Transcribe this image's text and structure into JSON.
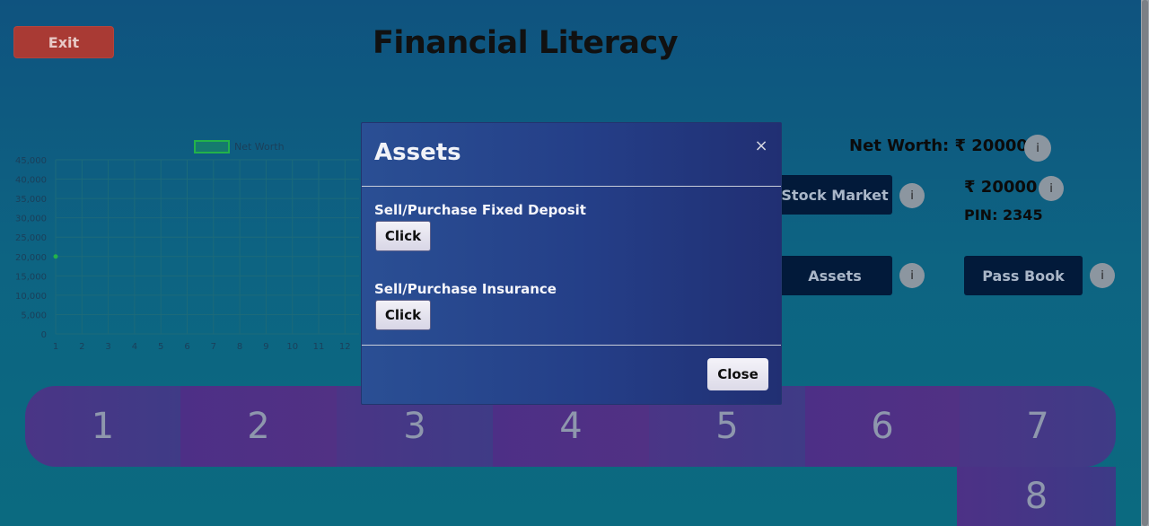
{
  "header": {
    "exit_label": "Exit",
    "title": "Financial Literacy"
  },
  "chart_data": {
    "type": "line",
    "legend": [
      "Net Worth"
    ],
    "x": [
      1,
      2,
      3,
      4,
      5,
      6,
      7,
      8,
      9,
      10,
      11,
      12
    ],
    "series": [
      {
        "name": "Net Worth",
        "values": [
          20000
        ]
      }
    ],
    "y_ticks": [
      "45,000",
      "40,000",
      "35,000",
      "30,000",
      "25,000",
      "20,000",
      "15,000",
      "10,000",
      "5,000",
      "0"
    ],
    "x_ticks": [
      "1",
      "2",
      "3",
      "4",
      "5",
      "6",
      "7",
      "8",
      "9",
      "10",
      "11",
      "12"
    ],
    "ylim": [
      0,
      45000
    ],
    "grid": true,
    "legend_position": "top",
    "colors": {
      "series": "#23b24a",
      "grid": "#1c6a7a",
      "text": "#1b3f5a"
    }
  },
  "right_panel": {
    "net_worth_label": "Net Worth: ₹ 20000",
    "stock_market_label": "Stock Market",
    "balance_label": "₹ 20000",
    "pin_label": "PIN: 2345",
    "assets_label": "Assets",
    "pass_book_label": "Pass Book",
    "info_glyph": "i"
  },
  "board": {
    "tiles": [
      "1",
      "2",
      "3",
      "4",
      "5",
      "6",
      "7"
    ],
    "below_tile": "8"
  },
  "modal": {
    "title": "Assets",
    "close_x": "×",
    "options": [
      {
        "label": "Sell/Purchase Fixed Deposit",
        "button": "Click"
      },
      {
        "label": "Sell/Purchase Insurance",
        "button": "Click"
      }
    ],
    "close_label": "Close"
  }
}
